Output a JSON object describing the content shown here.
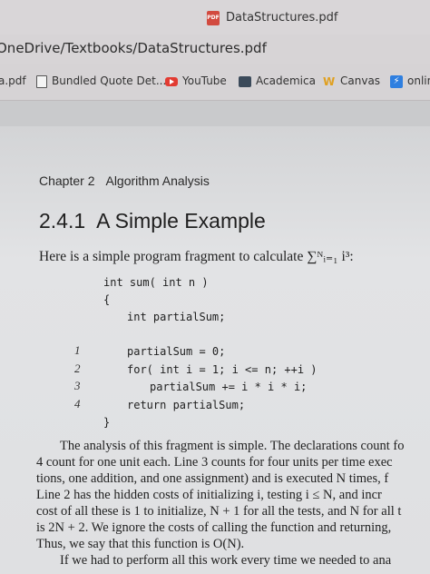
{
  "browser": {
    "tab_icon": "PDF",
    "tab_title": "DataStructures.pdf",
    "url": "OneDrive/Textbooks/DataStructures.pdf",
    "bookmarks": [
      {
        "label": "a.pdf",
        "icon": "none"
      },
      {
        "label": "Bundled Quote Det...",
        "icon": "document-icon"
      },
      {
        "label": "YouTube",
        "icon": "youtube-icon"
      },
      {
        "label": "Academica",
        "icon": "academica-icon"
      },
      {
        "label": "Canvas",
        "icon": "canvas-icon"
      },
      {
        "label": "onlin",
        "icon": "online-icon"
      }
    ]
  },
  "doc": {
    "chapter_number": "Chapter 2",
    "chapter_title": "Algorithm Analysis",
    "section_number": "2.4.1",
    "section_title": "A Simple Example",
    "intro": "Here is a simple program fragment to calculate ∑ᴺᵢ₌₁ i³:",
    "code_lines": [
      "int sum( int n )",
      "{",
      "int partialSum;",
      "partialSum = 0;",
      "for( int i = 1; i <= n; ++i )",
      "partialSum += i * i * i;",
      "return partialSum;",
      "}"
    ],
    "line_numbers": [
      "1",
      "2",
      "3",
      "4"
    ],
    "paragraph_lines": [
      "The analysis of this fragment is simple. The declarations count fo",
      "4 count for one unit each. Line 3 counts for four units per time exec",
      "tions, one addition, and one assignment) and is executed N times, f",
      "Line 2 has the hidden costs of initializing i, testing i ≤ N, and incr",
      "cost of all these is 1 to initialize, N + 1 for all the tests, and N for all t",
      "is 2N + 2. We ignore the costs of calling the function and returning,",
      "Thus, we say that this function is O(N).",
      "If we had to perform all this work every time we needed to ana"
    ]
  }
}
